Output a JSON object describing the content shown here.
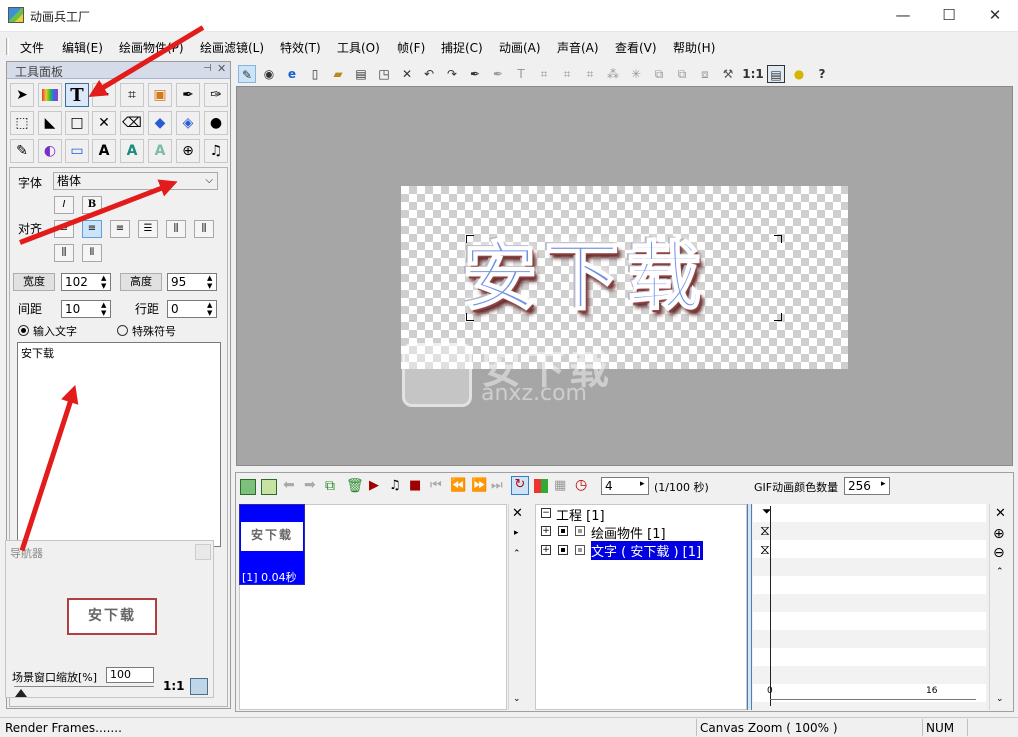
{
  "window": {
    "title": "动画兵工厂",
    "minimize": "—",
    "maximize": "☐",
    "close": "✕"
  },
  "menu": [
    "文件",
    "编辑(E)",
    "绘画物件(P)",
    "绘画滤镜(L)",
    "特效(T)",
    "工具(O)",
    "帧(F)",
    "捕捉(C)",
    "动画(A)",
    "声音(A)",
    "查看(V)",
    "帮助(H)"
  ],
  "tool_panel": {
    "title": "工具面板",
    "font_label": "字体",
    "font_value": "楷体",
    "align_label": "对齐",
    "width_label": "宽度",
    "width_value": "102",
    "height_label": "高度",
    "height_value": "95",
    "spacing_label": "间距",
    "spacing_value": "10",
    "linespacing_label": "行距",
    "linespacing_value": "0",
    "radio_input": "输入文字",
    "radio_special": "特殊符号",
    "text_value": "安下载",
    "bold": "B",
    "italic": "I"
  },
  "navigator": {
    "title": "导航器",
    "zoom_label": "场景窗口缩放[%]",
    "zoom_value": "100",
    "one_to_one": "1:1"
  },
  "toolbar": {
    "ratio": "1:1"
  },
  "canvas": {
    "art_text": "安下载",
    "watermark_main": "安下载",
    "watermark_sub": "anxz.com"
  },
  "timeline": {
    "fps_value": "4",
    "fps_unit": "(1/100 秒)",
    "gif_label": "GIF动画颜色数量",
    "gif_value": "256",
    "frame_caption": "[1] 0.04秒",
    "tree": [
      {
        "label": "工程 [1]"
      },
      {
        "label": "绘画物件 [1]"
      },
      {
        "label": "文字 ( 安下载 ) [1]"
      }
    ],
    "ruler": [
      "0",
      "16"
    ]
  },
  "status": {
    "left": "Render Frames.......",
    "zoom": "Canvas Zoom ( 100% )",
    "num": "NUM"
  },
  "colors": {
    "arrow": "#e21b1b",
    "selection": "#0000ff",
    "text_blue": "#5b7de0"
  }
}
